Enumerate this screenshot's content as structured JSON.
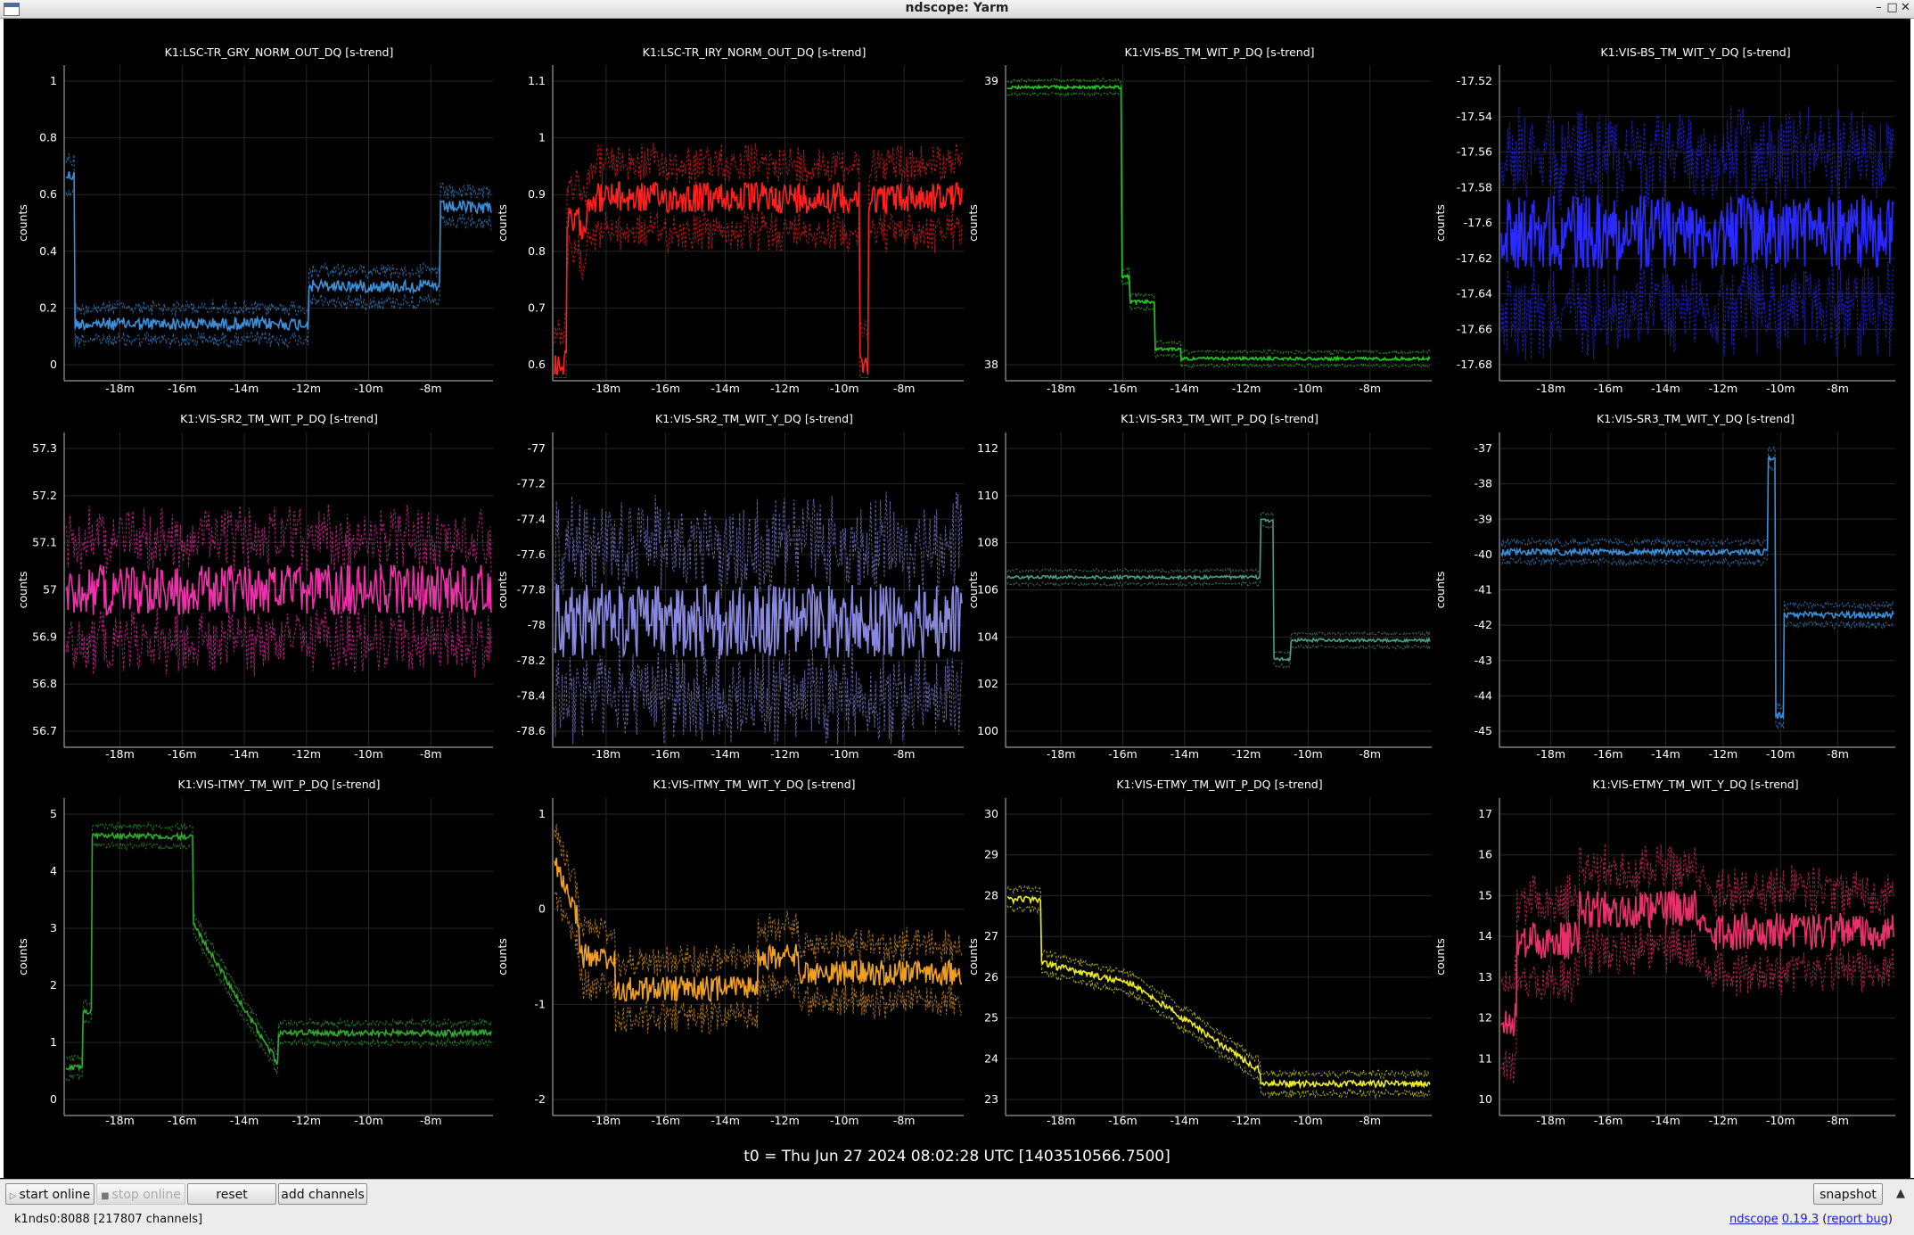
{
  "window": {
    "title": "ndscope: Yarm"
  },
  "plots": [
    {
      "title": "K1:LSC-TR_GRY_NORM_OUT_DQ [s-trend]",
      "ylabel": "counts",
      "color": "#3a8fd8",
      "yticks": [
        "1",
        "0.8",
        "0.6",
        "0.4",
        "0.2",
        "0"
      ],
      "xticks": [
        "-18m",
        "-16m",
        "-14m",
        "-12m",
        "-10m",
        "-8m"
      ]
    },
    {
      "title": "K1:LSC-TR_IRY_NORM_OUT_DQ [s-trend]",
      "ylabel": "counts",
      "color": "#ff2020",
      "yticks": [
        "1.1",
        "1",
        "0.9",
        "0.8",
        "0.7",
        "0.6"
      ],
      "xticks": [
        "-18m",
        "-16m",
        "-14m",
        "-12m",
        "-10m",
        "-8m"
      ]
    },
    {
      "title": "K1:VIS-BS_TM_WIT_P_DQ [s-trend]",
      "ylabel": "counts",
      "color": "#22cc22",
      "yticks": [
        "39",
        "38"
      ],
      "xticks": [
        "-18m",
        "-16m",
        "-14m",
        "-12m",
        "-10m",
        "-8m"
      ]
    },
    {
      "title": "K1:VIS-BS_TM_WIT_Y_DQ [s-trend]",
      "ylabel": "counts",
      "color": "#2a2aff",
      "yticks": [
        "-17.52",
        "-17.54",
        "-17.56",
        "-17.58",
        "-17.6",
        "-17.62",
        "-17.64",
        "-17.66",
        "-17.68"
      ],
      "xticks": [
        "-18m",
        "-16m",
        "-14m",
        "-12m",
        "-10m",
        "-8m"
      ]
    },
    {
      "title": "K1:VIS-SR2_TM_WIT_P_DQ [s-trend]",
      "ylabel": "counts",
      "color": "#ee30aa",
      "yticks": [
        "57.3",
        "57.2",
        "57.1",
        "57",
        "56.9",
        "56.8",
        "56.7"
      ],
      "xticks": [
        "-18m",
        "-16m",
        "-14m",
        "-12m",
        "-10m",
        "-8m"
      ]
    },
    {
      "title": "K1:VIS-SR2_TM_WIT_Y_DQ [s-trend]",
      "ylabel": "counts",
      "color": "#8888e0",
      "yticks": [
        "-77",
        "-77.2",
        "-77.4",
        "-77.6",
        "-77.8",
        "-78",
        "-78.2",
        "-78.4",
        "-78.6"
      ],
      "xticks": [
        "-18m",
        "-16m",
        "-14m",
        "-12m",
        "-10m",
        "-8m"
      ]
    },
    {
      "title": "K1:VIS-SR3_TM_WIT_P_DQ [s-trend]",
      "ylabel": "counts",
      "color": "#4a9a88",
      "yticks": [
        "112",
        "110",
        "108",
        "106",
        "104",
        "102",
        "100"
      ],
      "xticks": [
        "-18m",
        "-16m",
        "-14m",
        "-12m",
        "-10m",
        "-8m"
      ]
    },
    {
      "title": "K1:VIS-SR3_TM_WIT_Y_DQ [s-trend]",
      "ylabel": "counts",
      "color": "#3a8fd8",
      "yticks": [
        "-37",
        "-38",
        "-39",
        "-40",
        "-41",
        "-42",
        "-43",
        "-44",
        "-45"
      ],
      "xticks": [
        "-18m",
        "-16m",
        "-14m",
        "-12m",
        "-10m",
        "-8m"
      ]
    },
    {
      "title": "K1:VIS-ITMY_TM_WIT_P_DQ [s-trend]",
      "ylabel": "counts",
      "color": "#2eaa2e",
      "yticks": [
        "5",
        "4",
        "3",
        "2",
        "1",
        "0"
      ],
      "xticks": [
        "-18m",
        "-16m",
        "-14m",
        "-12m",
        "-10m",
        "-8m"
      ]
    },
    {
      "title": "K1:VIS-ITMY_TM_WIT_Y_DQ [s-trend]",
      "ylabel": "counts",
      "color": "#f0a020",
      "yticks": [
        "1",
        "0",
        "-1",
        "-2"
      ],
      "xticks": [
        "-18m",
        "-16m",
        "-14m",
        "-12m",
        "-10m",
        "-8m"
      ]
    },
    {
      "title": "K1:VIS-ETMY_TM_WIT_P_DQ [s-trend]",
      "ylabel": "counts",
      "color": "#eeee22",
      "yticks": [
        "30",
        "29",
        "28",
        "27",
        "26",
        "25",
        "24",
        "23"
      ],
      "xticks": [
        "-18m",
        "-16m",
        "-14m",
        "-12m",
        "-10m",
        "-8m"
      ]
    },
    {
      "title": "K1:VIS-ETMY_TM_WIT_Y_DQ [s-trend]",
      "ylabel": "counts",
      "color": "#e8306a",
      "yticks": [
        "17",
        "16",
        "15",
        "14",
        "13",
        "12",
        "11",
        "10"
      ],
      "xticks": [
        "-18m",
        "-16m",
        "-14m",
        "-12m",
        "-10m",
        "-8m"
      ]
    }
  ],
  "t0": "t0 = Thu Jun 27 2024 08:02:28 UTC [1403510566.7500]",
  "toolbar": {
    "start_online": "start online",
    "stop_online": "stop online",
    "reset": "reset",
    "add_channels": "add channels",
    "snapshot": "snapshot"
  },
  "status": {
    "server": "k1nds0:8088  [217807 channels]"
  },
  "version": {
    "app": "ndscope",
    "ver": "0.19.3",
    "report": "report bug"
  }
}
